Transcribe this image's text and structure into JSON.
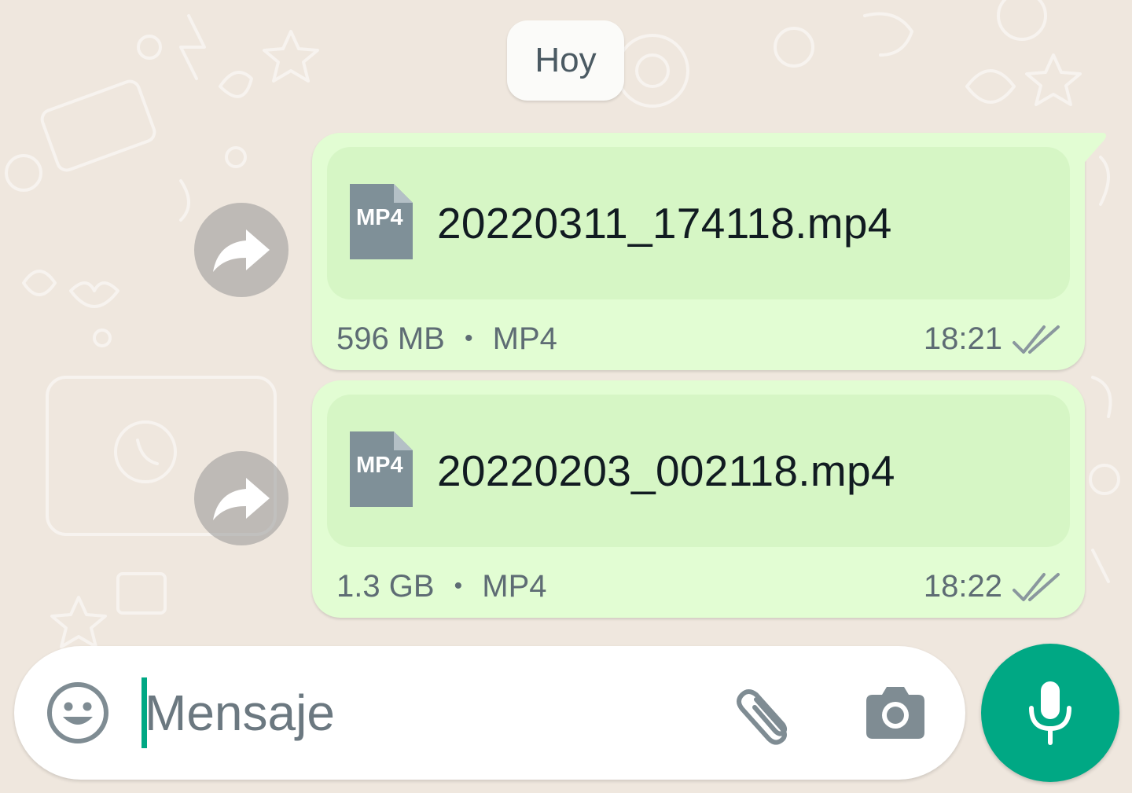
{
  "chat": {
    "date_label": "Hoy",
    "messages": [
      {
        "file_type_badge": "MP4",
        "file_name": "20220311_174118.mp4",
        "file_size": "596 MB",
        "separator": "•",
        "file_format": "MP4",
        "time": "18:21",
        "status_icon": "double-check-icon"
      },
      {
        "file_type_badge": "MP4",
        "file_name": "20220203_002118.mp4",
        "file_size": "1.3 GB",
        "separator": "•",
        "file_format": "MP4",
        "time": "18:22",
        "status_icon": "double-check-icon"
      }
    ]
  },
  "composer": {
    "placeholder": "Mensaje",
    "icons": [
      "emoji-icon",
      "paperclip-icon",
      "camera-icon",
      "microphone-icon"
    ]
  },
  "colors": {
    "outgoing_bubble": "#e2fdd3",
    "file_card": "#d6f6c5",
    "accent": "#00a884",
    "wallpaper": "#efe7de"
  }
}
